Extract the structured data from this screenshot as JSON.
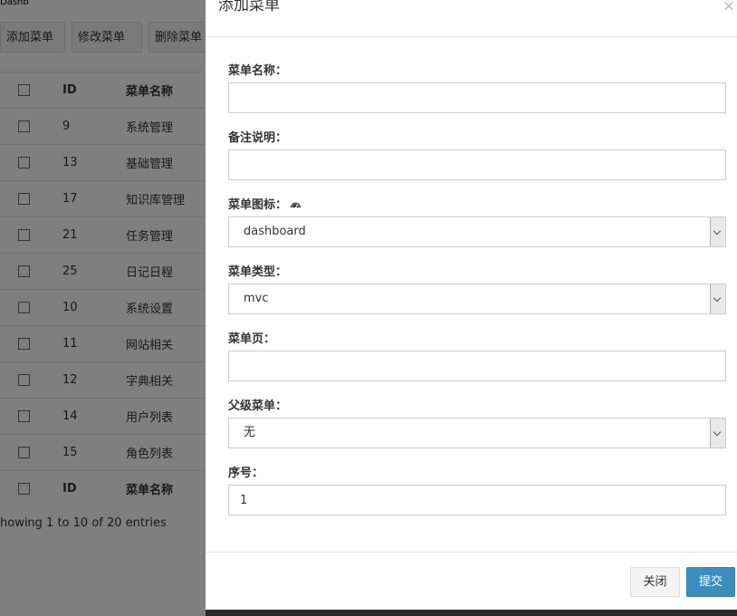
{
  "background": {
    "top_text": "Dashb",
    "toolbar": {
      "add_label": "添加菜单",
      "edit_label": "修改菜单",
      "delete_label": "删除菜单"
    },
    "table": {
      "headers": [
        "ID",
        "菜单名称"
      ],
      "rows": [
        {
          "id": "9",
          "name": "系统管理"
        },
        {
          "id": "13",
          "name": "基础管理"
        },
        {
          "id": "17",
          "name": "知识库管理"
        },
        {
          "id": "21",
          "name": "任务管理"
        },
        {
          "id": "25",
          "name": "日记日程"
        },
        {
          "id": "10",
          "name": "系统设置"
        },
        {
          "id": "11",
          "name": "网站相关"
        },
        {
          "id": "12",
          "name": "字典相关"
        },
        {
          "id": "14",
          "name": "用户列表"
        },
        {
          "id": "15",
          "name": "角色列表"
        }
      ],
      "footer_headers": [
        "ID",
        "菜单名称"
      ]
    },
    "entries_text": "howing 1 to 10 of 20 entries"
  },
  "modal": {
    "title": "添加菜单",
    "close_glyph": "×",
    "fields": {
      "menu_name": {
        "label": "菜单名称：",
        "value": ""
      },
      "remark": {
        "label": "备注说明：",
        "value": ""
      },
      "icon": {
        "label": "菜单图标：",
        "value": "dashboard",
        "icon": "dashboard-icon"
      },
      "type": {
        "label": "菜单类型：",
        "value": "mvc"
      },
      "page": {
        "label": "菜单页：",
        "value": ""
      },
      "parent": {
        "label": "父级菜单：",
        "value": "无"
      },
      "order": {
        "label": "序号：",
        "value": "1"
      }
    },
    "footer": {
      "close_label": "关闭",
      "submit_label": "提交"
    }
  },
  "colors": {
    "primary": "#3c8dbc",
    "overlay": "#000000"
  }
}
